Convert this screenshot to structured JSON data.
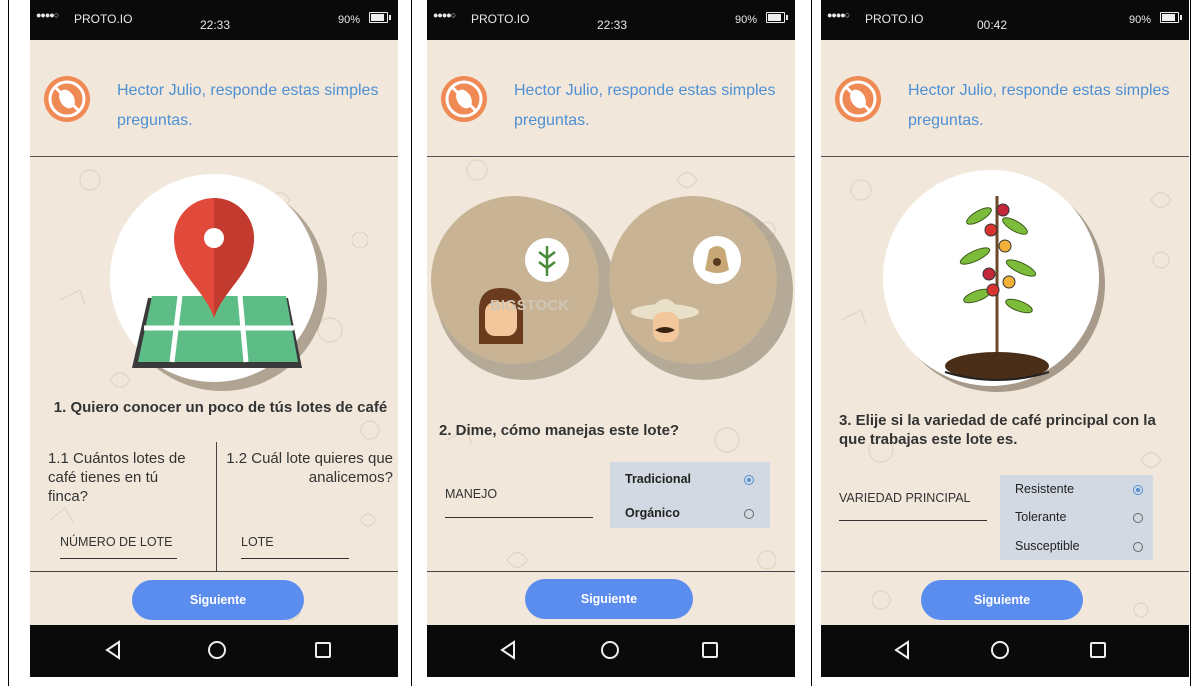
{
  "screens": [
    {
      "status": {
        "carrier": "PROTO.IO",
        "time": "22:33",
        "battery": "90%"
      },
      "greeting": "Hector Julio, responde estas simples preguntas.",
      "question": "1. Quiero conocer un poco de tús lotes de café",
      "sub_left": "1.1 Cuántos lotes de café tienes en tú finca?",
      "sub_right": "1.2 Cuál lote quieres que analicemos?",
      "field_left": "NÚMERO DE LOTE",
      "field_right": "LOTE",
      "button": "Siguiente"
    },
    {
      "status": {
        "carrier": "PROTO.IO",
        "time": "22:33",
        "battery": "90%"
      },
      "greeting": "Hector Julio, responde estas simples preguntas.",
      "watermark": "BIGSTOCK",
      "question": "2. Dime, cómo manejas este lote?",
      "field": "MANEJO",
      "options": [
        {
          "label": "Tradicional",
          "selected": true
        },
        {
          "label": "Orgánico",
          "selected": false
        }
      ],
      "button": "Siguiente"
    },
    {
      "status": {
        "carrier": "PROTO.IO",
        "time": "00:42",
        "battery": "90%"
      },
      "greeting": "Hector Julio, responde estas simples preguntas.",
      "question": "3. Elije si la variedad de café principal con la que trabajas este lote es.",
      "field": "VARIEDAD PRINCIPAL",
      "options": [
        {
          "label": "Resistente",
          "selected": true
        },
        {
          "label": "Tolerante",
          "selected": false
        },
        {
          "label": "Susceptible",
          "selected": false
        }
      ],
      "button": "Siguiente"
    }
  ],
  "colors": {
    "accent": "#5b8def",
    "greeting": "#4f8fd3",
    "logo": "#ef8a55",
    "background": "#f1e8db"
  }
}
